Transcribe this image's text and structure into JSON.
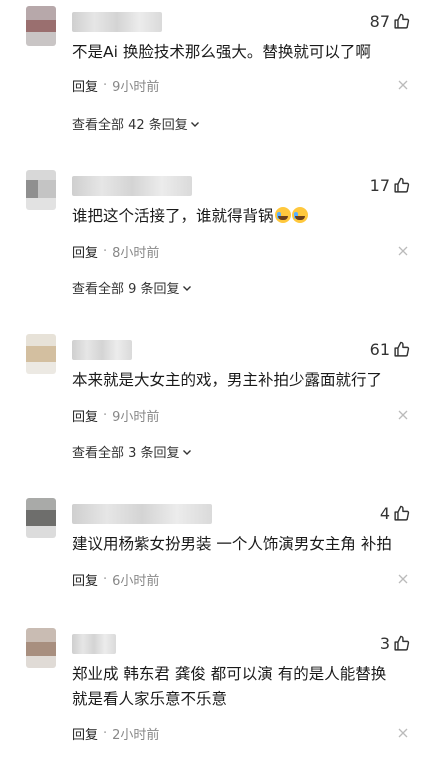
{
  "comments": [
    {
      "likes": "87",
      "text": "不是Ai 换脸技术那么强大。替换就可以了啊",
      "reply_label": "回复",
      "time": "9小时前",
      "replies_label": "查看全部 42 条回复"
    },
    {
      "likes": "17",
      "text": "谁把这个活接了，谁就得背锅",
      "emoji": [
        "crying-laughing-emoji",
        "crying-laughing-emoji"
      ],
      "reply_label": "回复",
      "time": "8小时前",
      "replies_label": "查看全部 9 条回复"
    },
    {
      "likes": "61",
      "text": "本来就是大女主的戏，男主补拍少露面就行了",
      "reply_label": "回复",
      "time": "9小时前",
      "replies_label": "查看全部 3 条回复"
    },
    {
      "likes": "4",
      "text": "建议用杨紫女扮男装 一个人饰演男女主角 补拍",
      "reply_label": "回复",
      "time": "6小时前"
    },
    {
      "likes": "3",
      "text_line1": "郑业成 韩东君 龚俊 都可以演 有的是人能替换",
      "text_line2": "就是看人家乐意不乐意",
      "reply_label": "回复",
      "time": "2小时前"
    }
  ],
  "colors": {
    "text": "#1a1a1a",
    "muted": "#888888",
    "background": "#ffffff"
  },
  "icons": {
    "like": "thumbs-up-icon",
    "close": "close-icon",
    "expand": "chevron-down-icon"
  }
}
